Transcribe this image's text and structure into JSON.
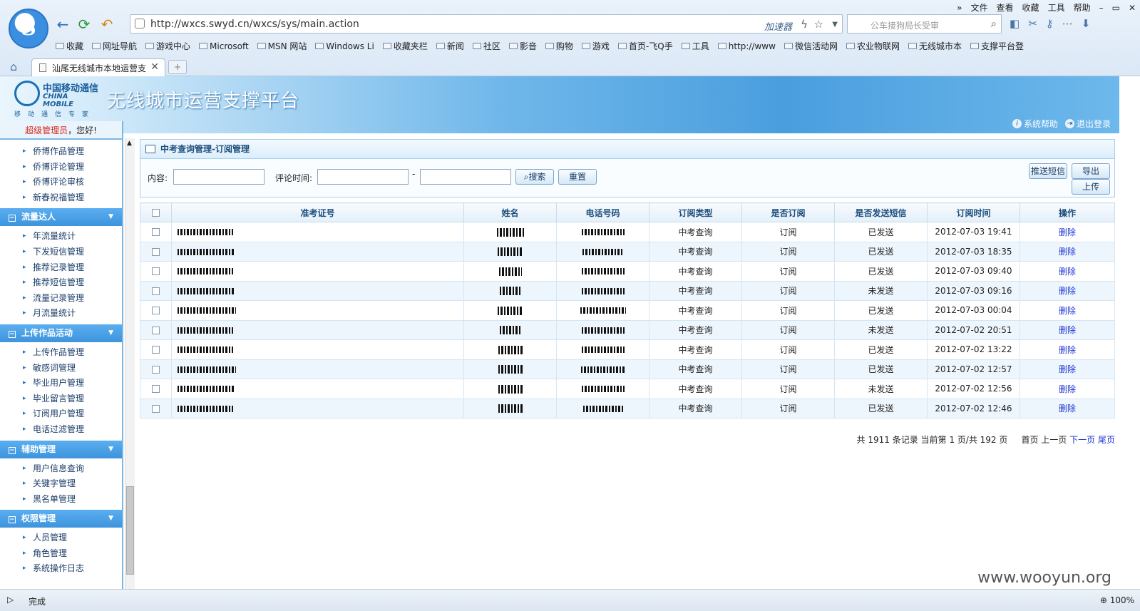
{
  "browser": {
    "url": "http://wxcs.swyd.cn/wxcs/sys/main.action",
    "accelerator": "加速器",
    "search_placeholder": "公车接狗局长受审",
    "menu": [
      "»",
      "文件",
      "查看",
      "收藏",
      "工具",
      "帮助"
    ],
    "bookmarks": [
      "收藏",
      "网址导航",
      "游戏中心",
      "Microsoft",
      "MSN 网站",
      "Windows Li",
      "收藏夹栏",
      "新闻",
      "社区",
      "影音",
      "购物",
      "游戏",
      "首页-飞Q手",
      "工具",
      "http://www",
      "微信活动网",
      "农业物联网",
      "无线城市本",
      "支撑平台登"
    ],
    "tab_title": "汕尾无线城市本地运营支",
    "status_text": "完成",
    "zoom": "100%",
    "watermark": "www.wooyun.org"
  },
  "header": {
    "logo_cn": "中国移动通信",
    "logo_en": "CHINA MOBILE",
    "logo_slogan": "移动通信专家",
    "title": "无线城市运营支撑平台",
    "help": "系统帮助",
    "logout": "退出登录"
  },
  "sidebar": {
    "greet_role": "超级管理员",
    "greet_text": "，您好!",
    "top_items": [
      "侨博作品管理",
      "侨博评论管理",
      "侨博评论审核",
      "新春祝福管理"
    ],
    "groups": [
      {
        "title": "流量达人",
        "items": [
          "年流量统计",
          "下发短信管理",
          "推荐记录管理",
          "推荐短信管理",
          "流量记录管理",
          "月流量统计"
        ]
      },
      {
        "title": "上传作品活动",
        "items": [
          "上传作品管理",
          "敏感词管理",
          "毕业用户管理",
          "毕业留言管理",
          "订阅用户管理",
          "电话过滤管理"
        ]
      },
      {
        "title": "辅助管理",
        "items": [
          "用户信息查询",
          "关键字管理",
          "黑名单管理"
        ]
      },
      {
        "title": "权限管理",
        "items": [
          "人员管理",
          "角色管理",
          "系统操作日志"
        ]
      }
    ]
  },
  "panel": {
    "title": "中考查询管理-订阅管理",
    "content_label": "内容:",
    "time_label": "评论时间:",
    "dash": "-",
    "search_btn": "搜索",
    "reset_btn": "重置",
    "sms_btn": "推送短信",
    "export_btn": "导出",
    "upload_btn": "上传"
  },
  "table": {
    "headers": [
      "准考证号",
      "姓名",
      "电话号码",
      "订阅类型",
      "是否订阅",
      "是否发送短信",
      "订阅时间",
      "操作"
    ],
    "rows": [
      {
        "type": "中考查询",
        "sub": "订阅",
        "sent": "已发送",
        "time": "2012-07-03 19:41",
        "op": "删除"
      },
      {
        "type": "中考查询",
        "sub": "订阅",
        "sent": "已发送",
        "time": "2012-07-03 18:35",
        "op": "删除"
      },
      {
        "type": "中考查询",
        "sub": "订阅",
        "sent": "已发送",
        "time": "2012-07-03 09:40",
        "op": "删除"
      },
      {
        "type": "中考查询",
        "sub": "订阅",
        "sent": "未发送",
        "time": "2012-07-03 09:16",
        "op": "删除"
      },
      {
        "type": "中考查询",
        "sub": "订阅",
        "sent": "已发送",
        "time": "2012-07-03 00:04",
        "op": "删除"
      },
      {
        "type": "中考查询",
        "sub": "订阅",
        "sent": "未发送",
        "time": "2012-07-02 20:51",
        "op": "删除"
      },
      {
        "type": "中考查询",
        "sub": "订阅",
        "sent": "已发送",
        "time": "2012-07-02 13:22",
        "op": "删除"
      },
      {
        "type": "中考查询",
        "sub": "订阅",
        "sent": "已发送",
        "time": "2012-07-02 12:57",
        "op": "删除"
      },
      {
        "type": "中考查询",
        "sub": "订阅",
        "sent": "未发送",
        "time": "2012-07-02 12:56",
        "op": "删除"
      },
      {
        "type": "中考查询",
        "sub": "订阅",
        "sent": "已发送",
        "time": "2012-07-02 12:46",
        "op": "删除"
      }
    ]
  },
  "pager": {
    "text": "共 1911 条记录 当前第 1 页/共 192 页",
    "first": "首页",
    "prev": "上一页",
    "next": "下一页",
    "last": "尾页"
  }
}
